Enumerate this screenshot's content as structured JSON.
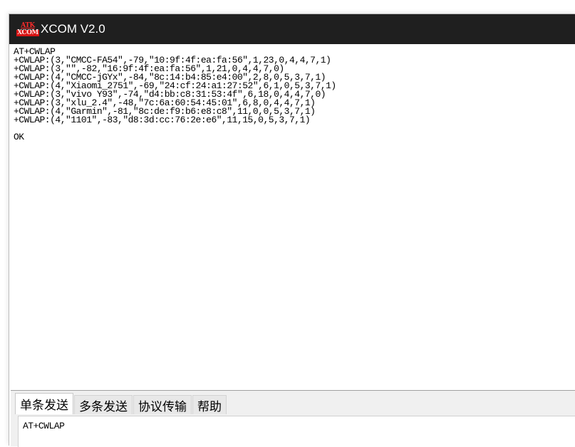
{
  "window": {
    "icon_text_top": "ATK",
    "icon_text_bottom": "XCOM",
    "title": "XCOM V2.0"
  },
  "receive": {
    "lines": [
      "AT+CWLAP",
      "+CWLAP:(3,\"CMCC-FA54\",-79,\"10:9f:4f:ea:fa:56\",1,23,0,4,4,7,1)",
      "+CWLAP:(3,\"\",-82,\"16:9f:4f:ea:fa:56\",1,21,0,4,4,7,0)",
      "+CWLAP:(4,\"CMCC-jGYx\",-84,\"8c:14:b4:85:e4:00\",2,8,0,5,3,7,1)",
      "+CWLAP:(4,\"Xiaomi_2751\",-69,\"24:cf:24:a1:27:52\",6,1,0,5,3,7,1)",
      "+CWLAP:(3,\"vivo Y93\",-74,\"d4:bb:c8:31:53:4f\",6,18,0,4,4,7,0)",
      "+CWLAP:(3,\"xlu_2.4\",-48,\"7c:6a:60:54:45:01\",6,8,0,4,4,7,1)",
      "+CWLAP:(4,\"Garmin\",-81,\"8c:de:f9:b6:e8:c8\",11,0,0,5,3,7,1)",
      "+CWLAP:(4,\"1101\",-83,\"d8:3d:cc:76:2e:e6\",11,15,0,5,3,7,1)",
      "",
      "OK"
    ]
  },
  "tabs": [
    {
      "label": "单条发送",
      "active": true
    },
    {
      "label": "多条发送",
      "active": false
    },
    {
      "label": "协议传输",
      "active": false
    },
    {
      "label": "帮助",
      "active": false
    }
  ],
  "send": {
    "value": "AT+CWLAP"
  },
  "colors": {
    "titlebar": "#1f1f1f",
    "icon_red": "#ff2a2a",
    "panel": "#f0f0f0"
  },
  "icons": {
    "app": "xcom-logo-icon"
  }
}
